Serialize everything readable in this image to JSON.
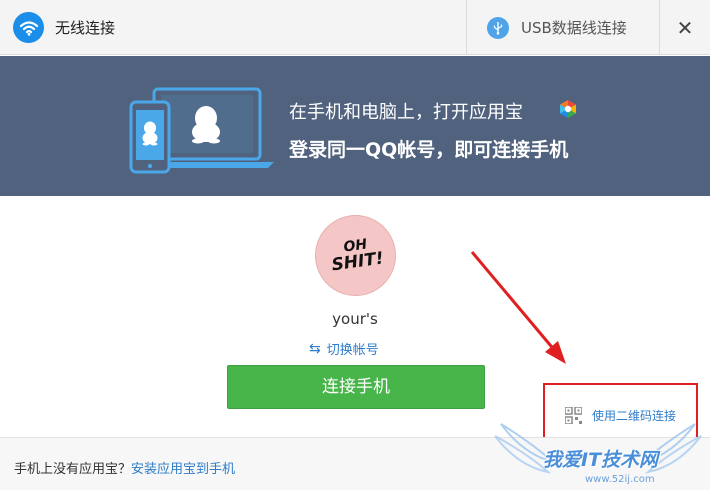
{
  "titlebar": {
    "wireless_tab_label": "无线连接",
    "usb_tab_label": "USB数据线连接",
    "close_glyph": "✕",
    "wireless_icon": "wifi-icon",
    "usb_icon": "usb-icon"
  },
  "banner": {
    "line1": "在手机和电脑上，打开应用宝",
    "line2": "登录同一QQ帐号，即可连接手机",
    "background_color": "#51627e"
  },
  "profile": {
    "avatar_text_line1": "OH",
    "avatar_text_line2": "SHIT!",
    "username": "your's",
    "switch_account_label": "切换帐号",
    "switch_icon": "⇆"
  },
  "actions": {
    "connect_button_label": "连接手机",
    "connect_button_color": "#48b54a",
    "qr_link_label": "使用二维码连接"
  },
  "footer": {
    "prompt_text": "手机上没有应用宝？",
    "install_link_label": "安装应用宝到手机"
  },
  "watermark": {
    "text": "我爱IT技术网",
    "url": "www.52ij.com"
  },
  "colors": {
    "link": "#2f7cc8",
    "accent_blue": "#1a8ee9",
    "annotation_red": "#e02020"
  }
}
